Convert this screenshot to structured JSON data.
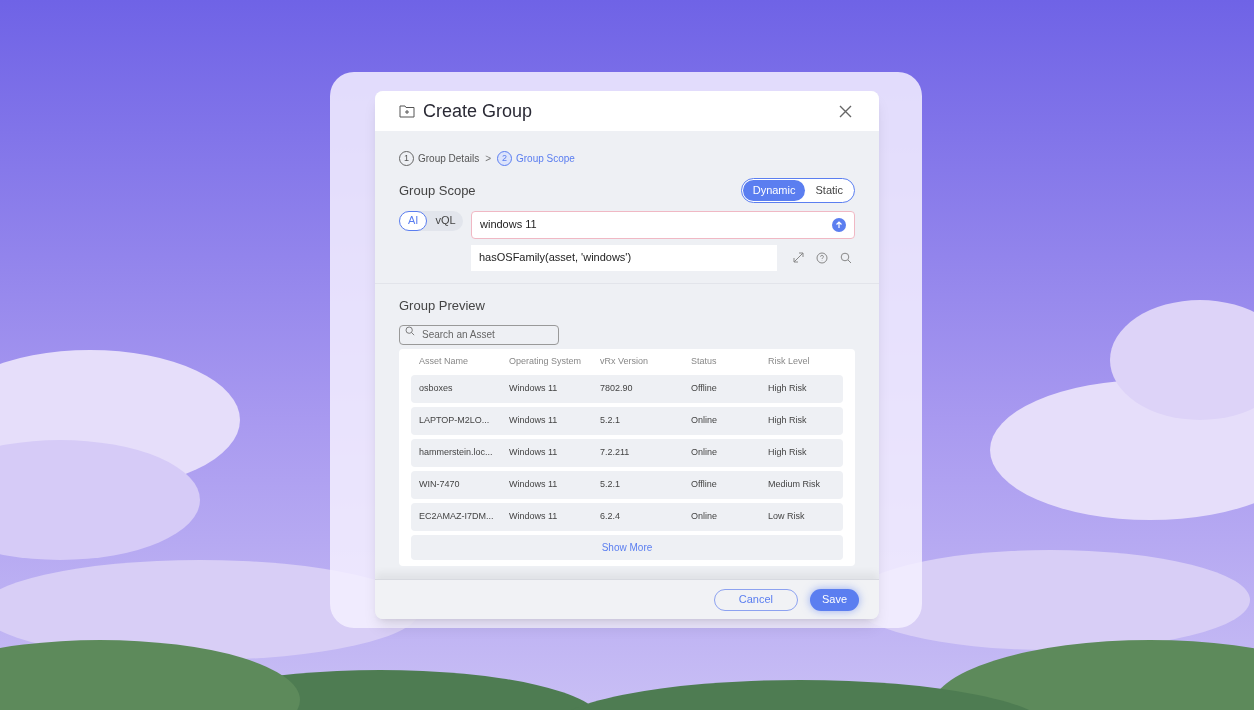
{
  "dialog": {
    "title": "Create Group",
    "steps": [
      {
        "number": "1",
        "label": "Group Details",
        "selected": false
      },
      {
        "number": "2",
        "label": "Group Scope",
        "selected": true
      }
    ],
    "separator": ">",
    "scope": {
      "title": "Group Scope",
      "types": [
        {
          "label": "Dynamic",
          "selected": true
        },
        {
          "label": "Static",
          "selected": false
        }
      ],
      "modes": [
        {
          "label": "AI",
          "selected": true
        },
        {
          "label": "vQL",
          "selected": false
        }
      ],
      "query": "windows 11",
      "expression": "hasOSFamily(asset, 'windows')"
    },
    "preview": {
      "title": "Group Preview",
      "search": {
        "placeholder": "Search an Asset"
      },
      "columns": [
        "Asset Name",
        "Operating System",
        "vRx Version",
        "Status",
        "Risk Level"
      ],
      "rows": [
        [
          "osboxes",
          "Windows 11",
          "7802.90",
          "Offline",
          "High Risk"
        ],
        [
          "LAPTOP-M2LO...",
          "Windows 11",
          "5.2.1",
          "Online",
          "High Risk"
        ],
        [
          "hammerstein.loc...",
          "Windows 11",
          "7.2.211",
          "Online",
          "High Risk"
        ],
        [
          "WIN-7470",
          "Windows 11",
          "5.2.1",
          "Offline",
          "Medium Risk"
        ],
        [
          "EC2AMAZ-I7DM...",
          "Windows 11",
          "6.2.4",
          "Online",
          "Low Risk"
        ]
      ],
      "show_more": "Show More"
    },
    "buttons": [
      {
        "label": "Cancel",
        "kind": "secondary"
      },
      {
        "label": "Save",
        "kind": "primary"
      }
    ]
  }
}
